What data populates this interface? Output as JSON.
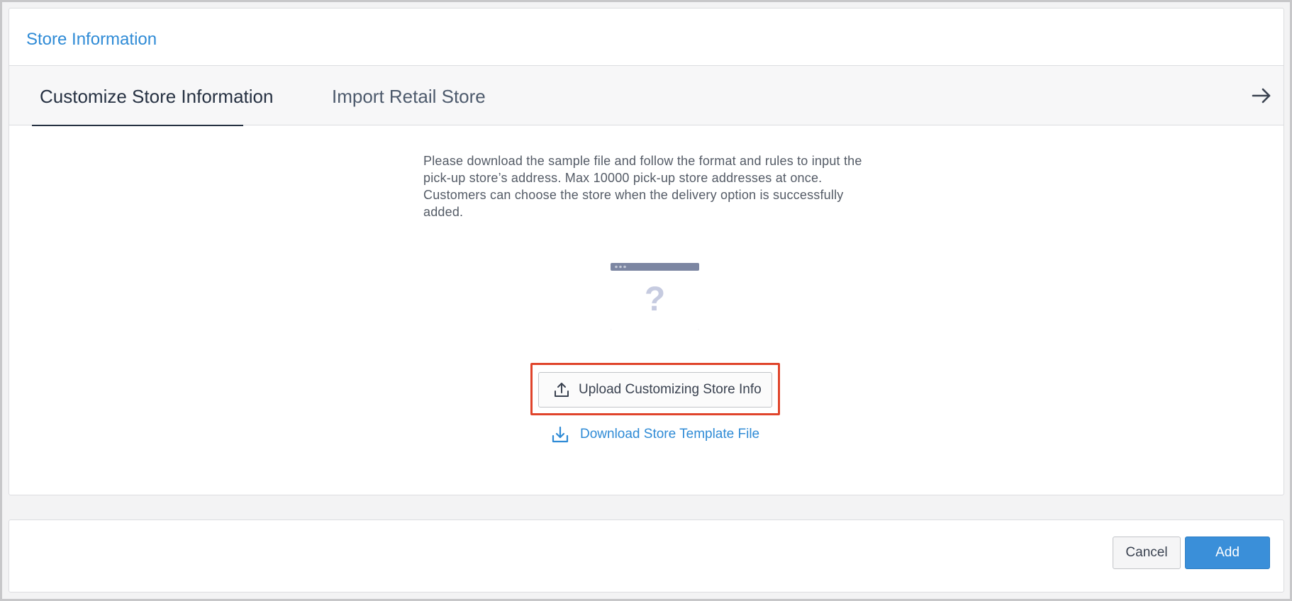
{
  "card": {
    "title": "Store Information"
  },
  "tabs": [
    {
      "label": "Customize Store Information",
      "active": true
    },
    {
      "label": "Import Retail Store",
      "active": false
    }
  ],
  "tabs_arrow_icon": "arrow-right-icon",
  "description": "Please download the sample file and follow the format and rules to input the pick-up store’s address. Max 10000 pick-up store addresses at once. Customers can choose the store when the delivery option is successfully added.",
  "illustration": {
    "icon": "empty-window-question-icon",
    "glyph": "?"
  },
  "upload_button": {
    "label": "Upload Customizing Store Info",
    "icon": "upload-icon",
    "highlighted": true
  },
  "download_link": {
    "label": "Download Store Template File",
    "icon": "download-icon"
  },
  "footer": {
    "cancel_label": "Cancel",
    "add_label": "Add"
  },
  "colors": {
    "accent": "#2f8bd6",
    "primary_button": "#3a8fd9",
    "highlight_border": "#e0442b",
    "tab_active": "#263142"
  }
}
